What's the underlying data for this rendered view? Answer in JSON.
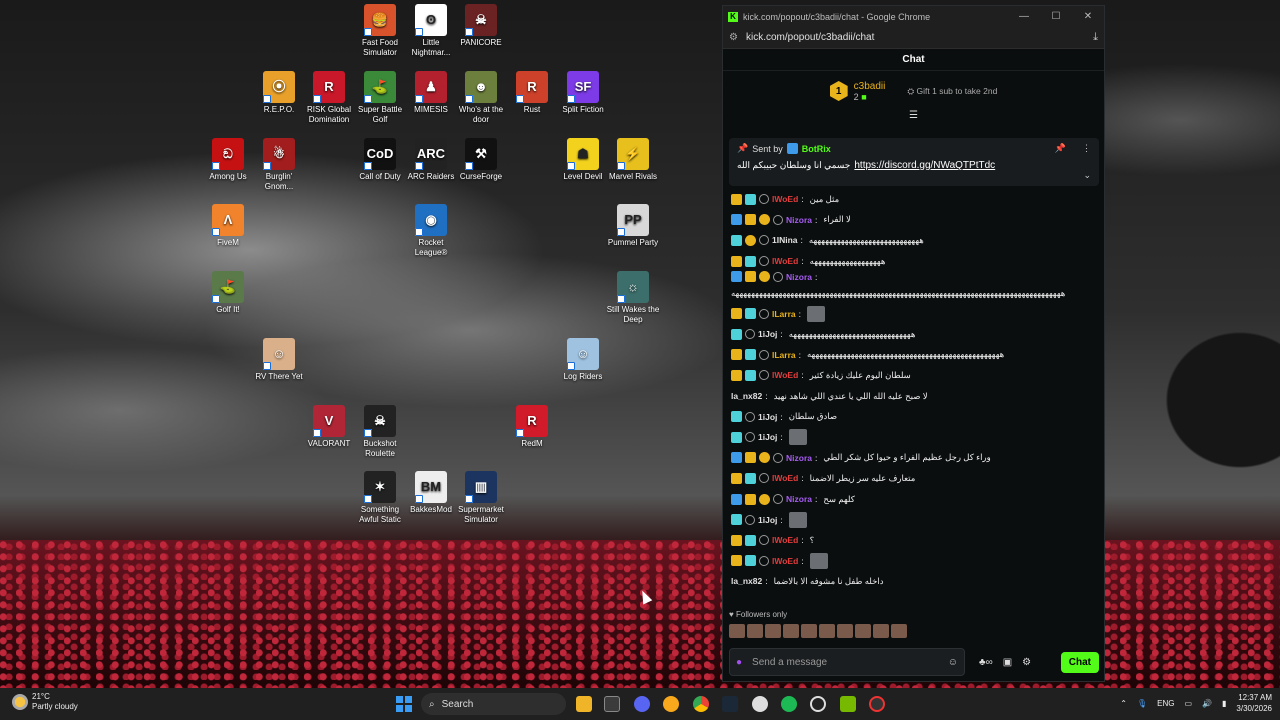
{
  "desktop": {
    "icons": [
      {
        "label": "Fast Food Simulator",
        "color": "#d8532c",
        "glyph": "🍔"
      },
      {
        "label": "Little Nightmar...",
        "color": "#ffffff",
        "glyph": "ʘ"
      },
      {
        "label": "PANICORE",
        "color": "#6b2222",
        "glyph": "☠"
      },
      {
        "label": "R.E.P.O.",
        "color": "#e8a02a",
        "glyph": "⦿"
      },
      {
        "label": "RISK Global Domination",
        "color": "#c8182a",
        "glyph": "R"
      },
      {
        "label": "Super Battle Golf",
        "color": "#3a8a3a",
        "glyph": "⛳"
      },
      {
        "label": "MIMESIS",
        "color": "#b3202e",
        "glyph": "♟"
      },
      {
        "label": "Who's at the door",
        "color": "#6d7f3d",
        "glyph": "☻"
      },
      {
        "label": "Rust",
        "color": "#cd412b",
        "glyph": "R"
      },
      {
        "label": "Split Fiction",
        "color": "#7c3be6",
        "glyph": "SF"
      },
      {
        "label": "Among Us",
        "color": "#c51111",
        "glyph": "ඞ"
      },
      {
        "label": "Burglin' Gnom...",
        "color": "#a21d1d",
        "glyph": "☃"
      },
      {
        "label": "Call of Duty",
        "color": "#111111",
        "glyph": "CoD"
      },
      {
        "label": "ARC Raiders",
        "color": "#222222",
        "glyph": "ARC"
      },
      {
        "label": "CurseForge",
        "color": "#111111",
        "glyph": "⚒"
      },
      {
        "label": "Level Devil",
        "color": "#f2d21c",
        "glyph": "☗"
      },
      {
        "label": "Marvel Rivals",
        "color": "#e7c01d",
        "glyph": "⚡"
      },
      {
        "label": "FiveM",
        "color": "#f0832c",
        "glyph": "Λ"
      },
      {
        "label": "Rocket League®",
        "color": "#1f6fc2",
        "glyph": "◉"
      },
      {
        "label": "Pummel Party",
        "color": "#d8d8d8",
        "glyph": "PP"
      },
      {
        "label": "Golf It!",
        "color": "#5a7a4a",
        "glyph": "⛳"
      },
      {
        "label": "Still Wakes the Deep",
        "color": "#3c6e6b",
        "glyph": "☼"
      },
      {
        "label": "RV There Yet",
        "color": "#d9b08a",
        "glyph": "☺"
      },
      {
        "label": "Log Riders",
        "color": "#9ec2e0",
        "glyph": "☺"
      },
      {
        "label": "VALORANT",
        "color": "#b02636",
        "glyph": "V"
      },
      {
        "label": "Buckshot Roulette",
        "color": "#222222",
        "glyph": "☠"
      },
      {
        "label": "RedM",
        "color": "#d11a2a",
        "glyph": "R"
      },
      {
        "label": "Something Awful Static",
        "color": "#222222",
        "glyph": "✶"
      },
      {
        "label": "BakkesMod",
        "color": "#eeeeee",
        "glyph": "BM"
      },
      {
        "label": "Supermarket Simulator",
        "color": "#1c3560",
        "glyph": "▥"
      }
    ]
  },
  "window": {
    "title": "kick.com/popout/c3badii/chat - Google Chrome",
    "url": "kick.com/popout/c3badii/chat"
  },
  "chat": {
    "header": "Chat",
    "gift": {
      "user": "c3badii",
      "count": "2",
      "rank": "1",
      "hint": "Gift 1 sub to take 2nd"
    },
    "pinned": {
      "sent_by": "Sent by",
      "bot": "BotRix",
      "text": "جسمي انا وسلطان حبيبكم الله",
      "link": "https://discord.gg/NWaQTPtTdc"
    },
    "messages": [
      {
        "user": "lWoEd",
        "color": "#e33c3c",
        "badges": [
          "crown",
          "og",
          "ver"
        ],
        "text": "مثل مين"
      },
      {
        "user": "Nizora",
        "color": "#a65df0",
        "badges": [
          "mod",
          "crown",
          "sub",
          "ver"
        ],
        "text": "لا الفراء"
      },
      {
        "user": "1INina",
        "color": "#e2e2e2",
        "badges": [
          "og",
          "sub",
          "ver"
        ],
        "text": "ههههههههههههههههههههههههههههه"
      },
      {
        "user": "lWoEd",
        "color": "#e33c3c",
        "badges": [
          "crown",
          "og",
          "ver"
        ],
        "text": "ههههههههههههههههههه"
      },
      {
        "user": "Nizora",
        "color": "#a65df0",
        "badges": [
          "mod",
          "crown",
          "sub",
          "ver"
        ],
        "text": "",
        "long": "ههههههههههههههههههههههههههههههههههههههههههههههههههههههههههههههههههههههههههههههههههههه"
      },
      {
        "user": "lLarra",
        "color": "#e9b31c",
        "badges": [
          "crown",
          "og",
          "ver"
        ],
        "text": "",
        "emote": true
      },
      {
        "user": "1iJoj",
        "color": "#e2e2e2",
        "badges": [
          "og",
          "ver"
        ],
        "text": "هههههههههههههههههههههههههههههههه"
      },
      {
        "user": "lLarra",
        "color": "#e9b31c",
        "badges": [
          "crown",
          "og",
          "ver"
        ],
        "text": "هههههههههههههههههههههههههههههههههههههههههههههههههه"
      },
      {
        "user": "lWoEd",
        "color": "#e33c3c",
        "badges": [
          "crown",
          "og",
          "ver"
        ],
        "text": "سلطان اليوم عليك زيادة كثير"
      },
      {
        "user": "la_nx82",
        "color": "#e2e2e2",
        "badges": [],
        "text": "لا صبح عليه الله اللي يا عندي اللي شاهد نهيد"
      },
      {
        "user": "1iJoj",
        "color": "#e2e2e2",
        "badges": [
          "og",
          "ver"
        ],
        "text": "صادق سلطان"
      },
      {
        "user": "1iJoj",
        "color": "#e2e2e2",
        "badges": [
          "og",
          "ver"
        ],
        "text": "",
        "emote": true
      },
      {
        "user": "Nizora",
        "color": "#a65df0",
        "badges": [
          "mod",
          "crown",
          "sub",
          "ver"
        ],
        "text": "وراء كل رجل عظيم الفراء و حيوا كل شكر الطي"
      },
      {
        "user": "lWoEd",
        "color": "#e33c3c",
        "badges": [
          "crown",
          "og",
          "ver"
        ],
        "text": "متعارف عليه سر زيطر الاضمنا"
      },
      {
        "user": "Nizora",
        "color": "#a65df0",
        "badges": [
          "mod",
          "crown",
          "sub",
          "ver"
        ],
        "text": "كلهم سح"
      },
      {
        "user": "1iJoj",
        "color": "#e2e2e2",
        "badges": [
          "og",
          "ver"
        ],
        "text": "",
        "emote": true
      },
      {
        "user": "lWoEd",
        "color": "#e33c3c",
        "badges": [
          "crown",
          "og",
          "ver"
        ],
        "text": "؟"
      },
      {
        "user": "lWoEd",
        "color": "#e33c3c",
        "badges": [
          "crown",
          "og",
          "ver"
        ],
        "text": "",
        "emote": true
      },
      {
        "user": "la_nx82",
        "color": "#e2e2e2",
        "badges": [],
        "text": "داخله طفل نا مشوفه الا بالاضما"
      }
    ],
    "followers_only": "Followers only",
    "input_placeholder": "Send a message",
    "send_label": "Chat"
  },
  "taskbar": {
    "weather_temp": "21°C",
    "weather_desc": "Partly cloudy",
    "search": "Search",
    "language": "ENG",
    "time": "12:37 AM",
    "date": "3/30/2026"
  }
}
